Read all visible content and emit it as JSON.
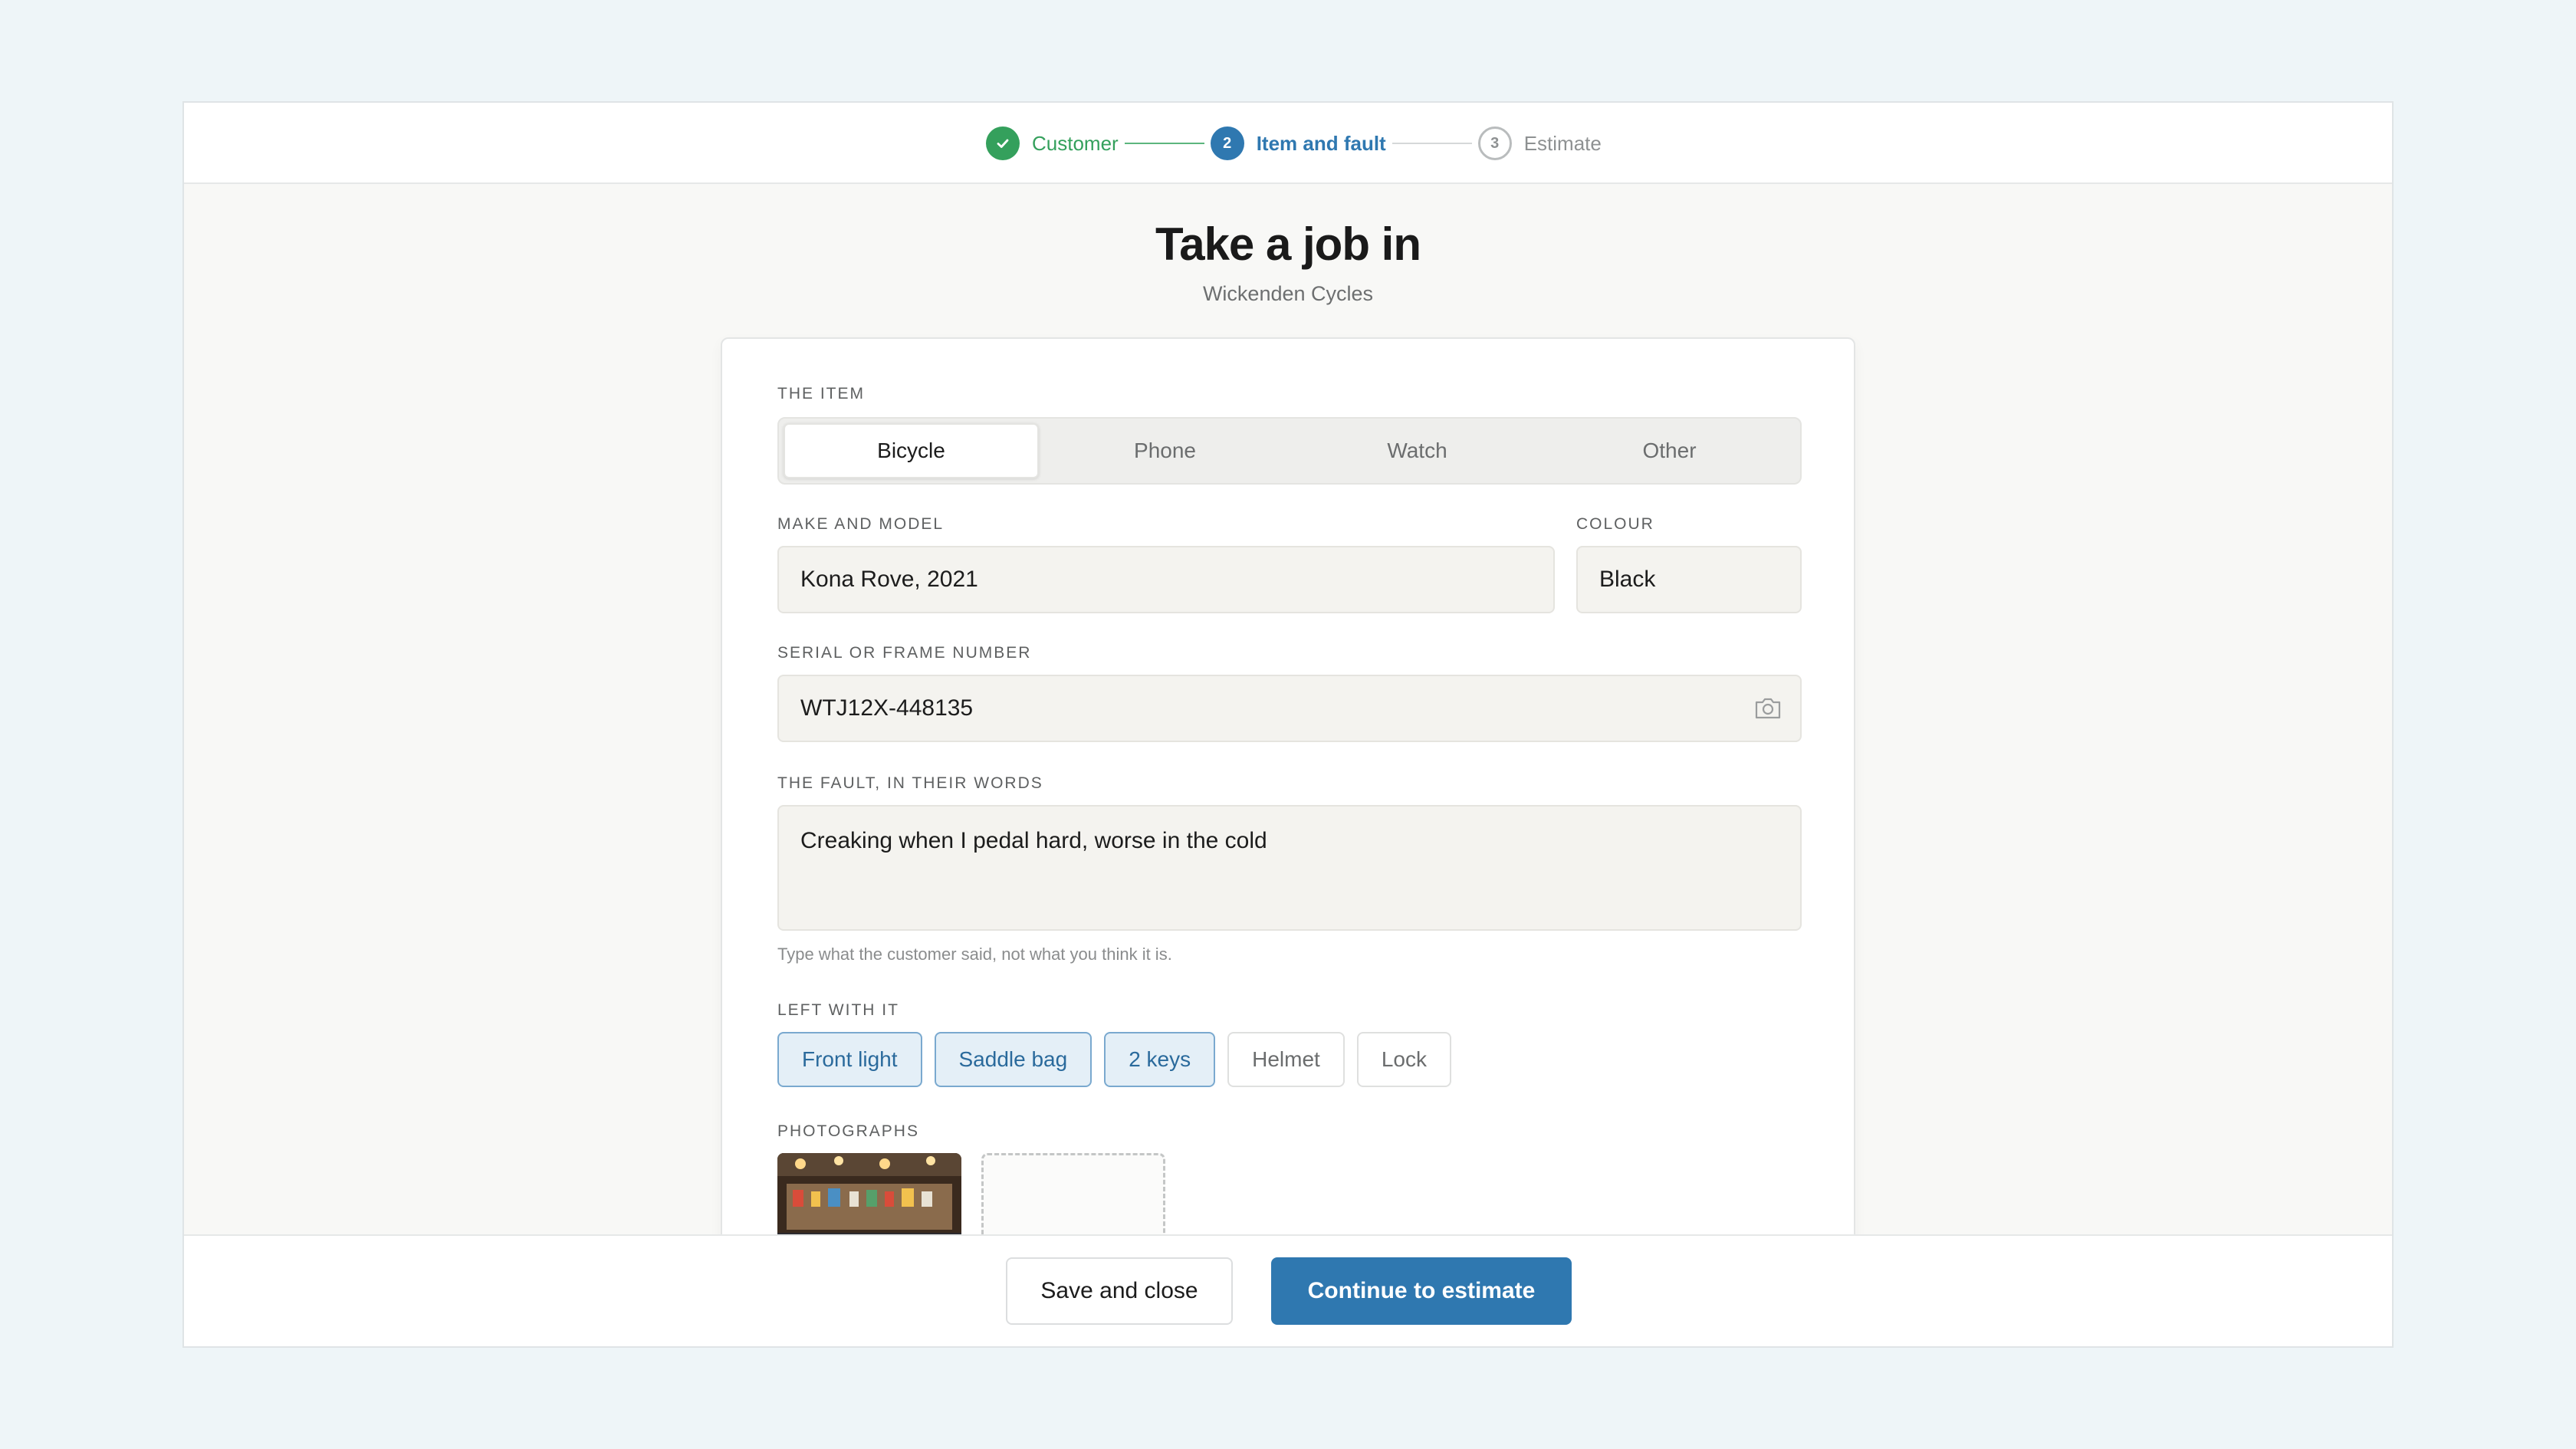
{
  "stepper": {
    "steps": [
      {
        "number": "1",
        "label": "Customer",
        "state": "done"
      },
      {
        "number": "2",
        "label": "Item and fault",
        "state": "active"
      },
      {
        "number": "3",
        "label": "Estimate",
        "state": "todo"
      }
    ]
  },
  "header": {
    "title": "Take a job in",
    "subtitle": "Wickenden Cycles"
  },
  "form": {
    "item": {
      "label": "The item",
      "options": [
        "Bicycle",
        "Phone",
        "Watch",
        "Other"
      ],
      "selected": "Bicycle"
    },
    "make_model": {
      "label": "Make and model",
      "value": "Kona Rove, 2021"
    },
    "colour": {
      "label": "Colour",
      "value": "Black"
    },
    "serial": {
      "label": "Serial or frame number",
      "value": "WTJ12X-448135",
      "icon": "camera-icon"
    },
    "fault": {
      "label": "The fault, in their words",
      "value": "Creaking when I pedal hard, worse in the cold",
      "hint": "Type what the customer said, not what you think it is."
    },
    "left_with_it": {
      "label": "Left with it",
      "items": [
        {
          "label": "Front light",
          "selected": true
        },
        {
          "label": "Saddle bag",
          "selected": true
        },
        {
          "label": "2 keys",
          "selected": true
        },
        {
          "label": "Helmet",
          "selected": false
        },
        {
          "label": "Lock",
          "selected": false
        }
      ]
    },
    "photographs": {
      "label": "Photographs",
      "add_icon": "plus-icon"
    }
  },
  "footer": {
    "save_label": "Save and close",
    "continue_label": "Continue to estimate"
  },
  "colors": {
    "accent": "#2f78b0",
    "success": "#34a05c",
    "background": "#eef5f8"
  }
}
